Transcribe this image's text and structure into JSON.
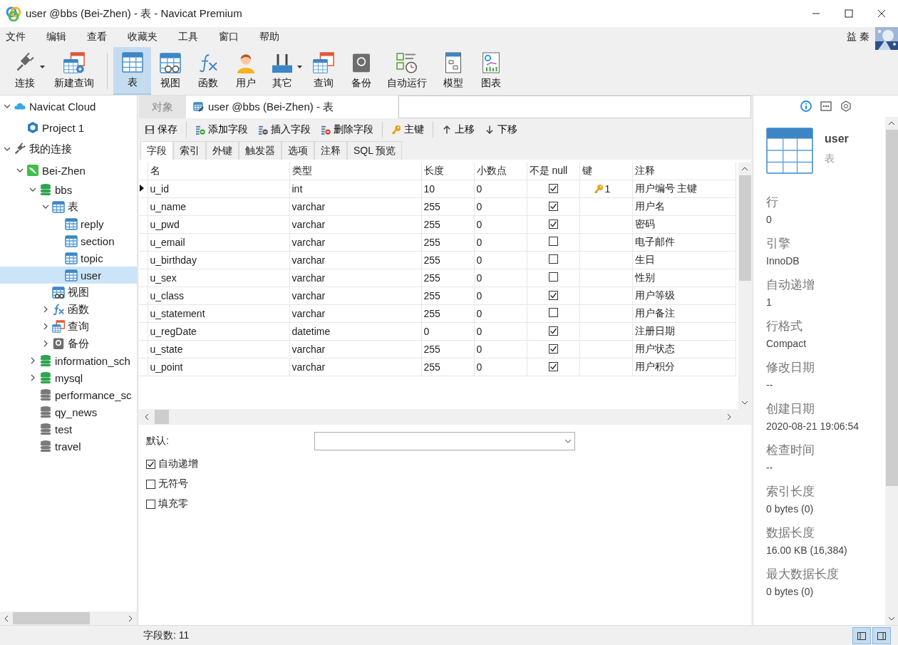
{
  "window": {
    "title": "user @bbs (Bei-Zhen) - 表 - Navicat Premium"
  },
  "menu": [
    "文件",
    "编辑",
    "查看",
    "收藏夹",
    "工具",
    "窗口",
    "帮助"
  ],
  "user_name": "益 秦",
  "toolbar": [
    {
      "label": "连接",
      "kind": "connect",
      "dropdown": true,
      "selected": false
    },
    {
      "label": "新建查询",
      "kind": "new-query",
      "dropdown": false,
      "selected": false
    },
    {
      "label": "表",
      "kind": "table",
      "dropdown": false,
      "selected": true
    },
    {
      "label": "视图",
      "kind": "view",
      "dropdown": false,
      "selected": false
    },
    {
      "label": "函数",
      "kind": "function",
      "dropdown": false,
      "selected": false
    },
    {
      "label": "用户",
      "kind": "user",
      "dropdown": false,
      "selected": false
    },
    {
      "label": "其它",
      "kind": "tools",
      "dropdown": true,
      "selected": false
    },
    {
      "label": "查询",
      "kind": "query",
      "dropdown": false,
      "selected": false
    },
    {
      "label": "备份",
      "kind": "backup",
      "dropdown": false,
      "selected": false
    },
    {
      "label": "自动运行",
      "kind": "autorun",
      "dropdown": false,
      "selected": false
    },
    {
      "label": "模型",
      "kind": "model",
      "dropdown": false,
      "selected": false
    },
    {
      "label": "图表",
      "kind": "chart",
      "dropdown": false,
      "selected": false
    }
  ],
  "sidebar": {
    "items": [
      {
        "label": "Navicat Cloud",
        "kind": "cloud",
        "expanded": true,
        "selected": false,
        "children": [
          {
            "label": "Project 1",
            "kind": "project",
            "selected": false
          }
        ]
      },
      {
        "label": "我的连接",
        "kind": "connect",
        "expanded": true,
        "selected": false,
        "children": [
          {
            "label": "Bei-Zhen",
            "kind": "mysql",
            "expanded": true,
            "selected": false,
            "children": [
              {
                "label": "bbs",
                "kind": "db",
                "expanded": true,
                "selected": false,
                "children": [
                  {
                    "label": "表",
                    "kind": "table",
                    "expanded": true,
                    "selected": false,
                    "children": [
                      {
                        "label": "reply",
                        "kind": "table",
                        "selected": false
                      },
                      {
                        "label": "section",
                        "kind": "table",
                        "selected": false
                      },
                      {
                        "label": "topic",
                        "kind": "table",
                        "selected": false
                      },
                      {
                        "label": "user",
                        "kind": "table",
                        "selected": true
                      }
                    ]
                  },
                  {
                    "label": "视图",
                    "kind": "view",
                    "selected": false
                  },
                  {
                    "label": "函数",
                    "kind": "function",
                    "expanded": false,
                    "selected": false
                  },
                  {
                    "label": "查询",
                    "kind": "query",
                    "expanded": false,
                    "selected": false
                  },
                  {
                    "label": "备份",
                    "kind": "backup",
                    "expanded": false,
                    "selected": false
                  }
                ]
              },
              {
                "label": "information_sch",
                "kind": "db",
                "expanded": false,
                "selected": false
              },
              {
                "label": "mysql",
                "kind": "db",
                "expanded": false,
                "selected": false
              },
              {
                "label": "performance_sc",
                "kind": "db-closed",
                "selected": false
              },
              {
                "label": "qy_news",
                "kind": "db-closed",
                "selected": false
              },
              {
                "label": "test",
                "kind": "db-closed",
                "selected": false
              },
              {
                "label": "travel",
                "kind": "db-closed",
                "selected": false
              }
            ]
          }
        ]
      }
    ]
  },
  "tabs": [
    {
      "label": "对象",
      "selected": false
    },
    {
      "label": "user @bbs (Bei-Zhen) - 表",
      "selected": true
    }
  ],
  "actions": [
    {
      "label": "保存",
      "kind": "save"
    },
    {
      "label": "添加字段",
      "kind": "add-field"
    },
    {
      "label": "插入字段",
      "kind": "insert-field"
    },
    {
      "label": "删除字段",
      "kind": "delete-field"
    },
    {
      "label": "主键",
      "kind": "key"
    },
    {
      "label": "上移",
      "kind": "up"
    },
    {
      "label": "下移",
      "kind": "down"
    }
  ],
  "subtabs": [
    {
      "label": "字段",
      "selected": true
    },
    {
      "label": "索引",
      "selected": false
    },
    {
      "label": "外键",
      "selected": false
    },
    {
      "label": "触发器",
      "selected": false
    },
    {
      "label": "选项",
      "selected": false
    },
    {
      "label": "注释",
      "selected": false
    },
    {
      "label": "SQL 预览",
      "selected": false
    }
  ],
  "table": {
    "columns": [
      "名",
      "类型",
      "长度",
      "小数点",
      "不是 null",
      "键",
      "注释"
    ],
    "rows": [
      {
        "name": "u_id",
        "type": "int",
        "length": "10",
        "decimals": "0",
        "not_null": true,
        "key": "1",
        "comment": "用户编号 主键",
        "current": true
      },
      {
        "name": "u_name",
        "type": "varchar",
        "length": "255",
        "decimals": "0",
        "not_null": true,
        "comment": "用户名",
        "current": false
      },
      {
        "name": "u_pwd",
        "type": "varchar",
        "length": "255",
        "decimals": "0",
        "not_null": true,
        "comment": "密码",
        "current": false
      },
      {
        "name": "u_email",
        "type": "varchar",
        "length": "255",
        "decimals": "0",
        "not_null": false,
        "comment": "电子邮件",
        "current": false
      },
      {
        "name": "u_birthday",
        "type": "varchar",
        "length": "255",
        "decimals": "0",
        "not_null": false,
        "comment": "生日",
        "current": false
      },
      {
        "name": "u_sex",
        "type": "varchar",
        "length": "255",
        "decimals": "0",
        "not_null": false,
        "comment": "性别",
        "current": false
      },
      {
        "name": "u_class",
        "type": "varchar",
        "length": "255",
        "decimals": "0",
        "not_null": true,
        "comment": "用户等级",
        "current": false
      },
      {
        "name": "u_statement",
        "type": "varchar",
        "length": "255",
        "decimals": "0",
        "not_null": false,
        "comment": "用户备注",
        "current": false
      },
      {
        "name": "u_regDate",
        "type": "datetime",
        "length": "0",
        "decimals": "0",
        "not_null": true,
        "comment": "注册日期",
        "current": false
      },
      {
        "name": "u_state",
        "type": "varchar",
        "length": "255",
        "decimals": "0",
        "not_null": true,
        "comment": "用户状态",
        "current": false
      },
      {
        "name": "u_point",
        "type": "varchar",
        "length": "255",
        "decimals": "0",
        "not_null": true,
        "comment": "用户积分",
        "current": false
      }
    ]
  },
  "field_options": {
    "default_label": "默认:",
    "options": [
      {
        "label": "自动递增",
        "checked": true
      },
      {
        "label": "无符号",
        "checked": false
      },
      {
        "label": "填充零",
        "checked": false
      }
    ]
  },
  "status_bar": "字段数: 11",
  "info": {
    "name": "user",
    "type": "表",
    "properties": [
      {
        "label": "行",
        "value": "0"
      },
      {
        "label": "引擎",
        "value": "InnoDB"
      },
      {
        "label": "自动递增",
        "value": "1"
      },
      {
        "label": "行格式",
        "value": "Compact"
      },
      {
        "label": "修改日期",
        "value": "--"
      },
      {
        "label": "创建日期",
        "value": "2020-08-21 19:06:54"
      },
      {
        "label": "检查时间",
        "value": "--"
      },
      {
        "label": "索引长度",
        "value": "0 bytes (0)"
      },
      {
        "label": "数据长度",
        "value": "16.00 KB (16,384)"
      },
      {
        "label": "最大数据长度",
        "value": "0 bytes (0)"
      }
    ]
  }
}
